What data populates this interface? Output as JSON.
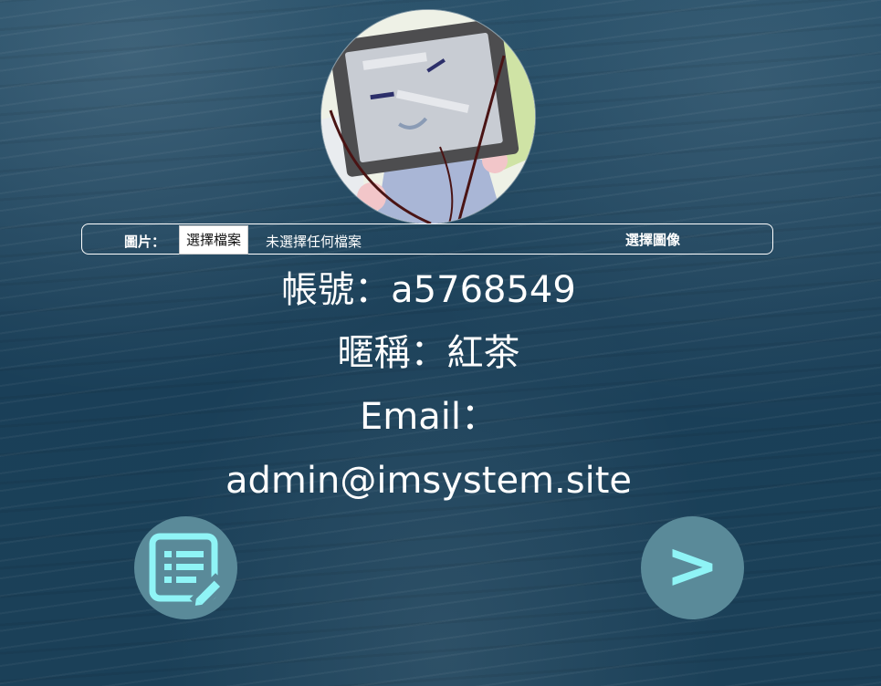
{
  "avatar": {
    "alt": "user avatar drawing"
  },
  "upload": {
    "label": "圖片：",
    "file_button": "選擇檔案",
    "file_status": "未選擇任何檔案",
    "select_image": "選擇圖像"
  },
  "profile": {
    "account_line": "帳號：a5768549",
    "nickname_line": "暱稱：紅茶",
    "email_label": "Email：",
    "email_value": "admin@imsystem.site"
  },
  "actions": {
    "edit_icon": "edit-list-icon",
    "next_label": ">"
  },
  "colors": {
    "background": "#1b4058",
    "button_fill": "#5a8a99",
    "icon_cyan": "#8ff4f6",
    "text": "#ffffff"
  }
}
